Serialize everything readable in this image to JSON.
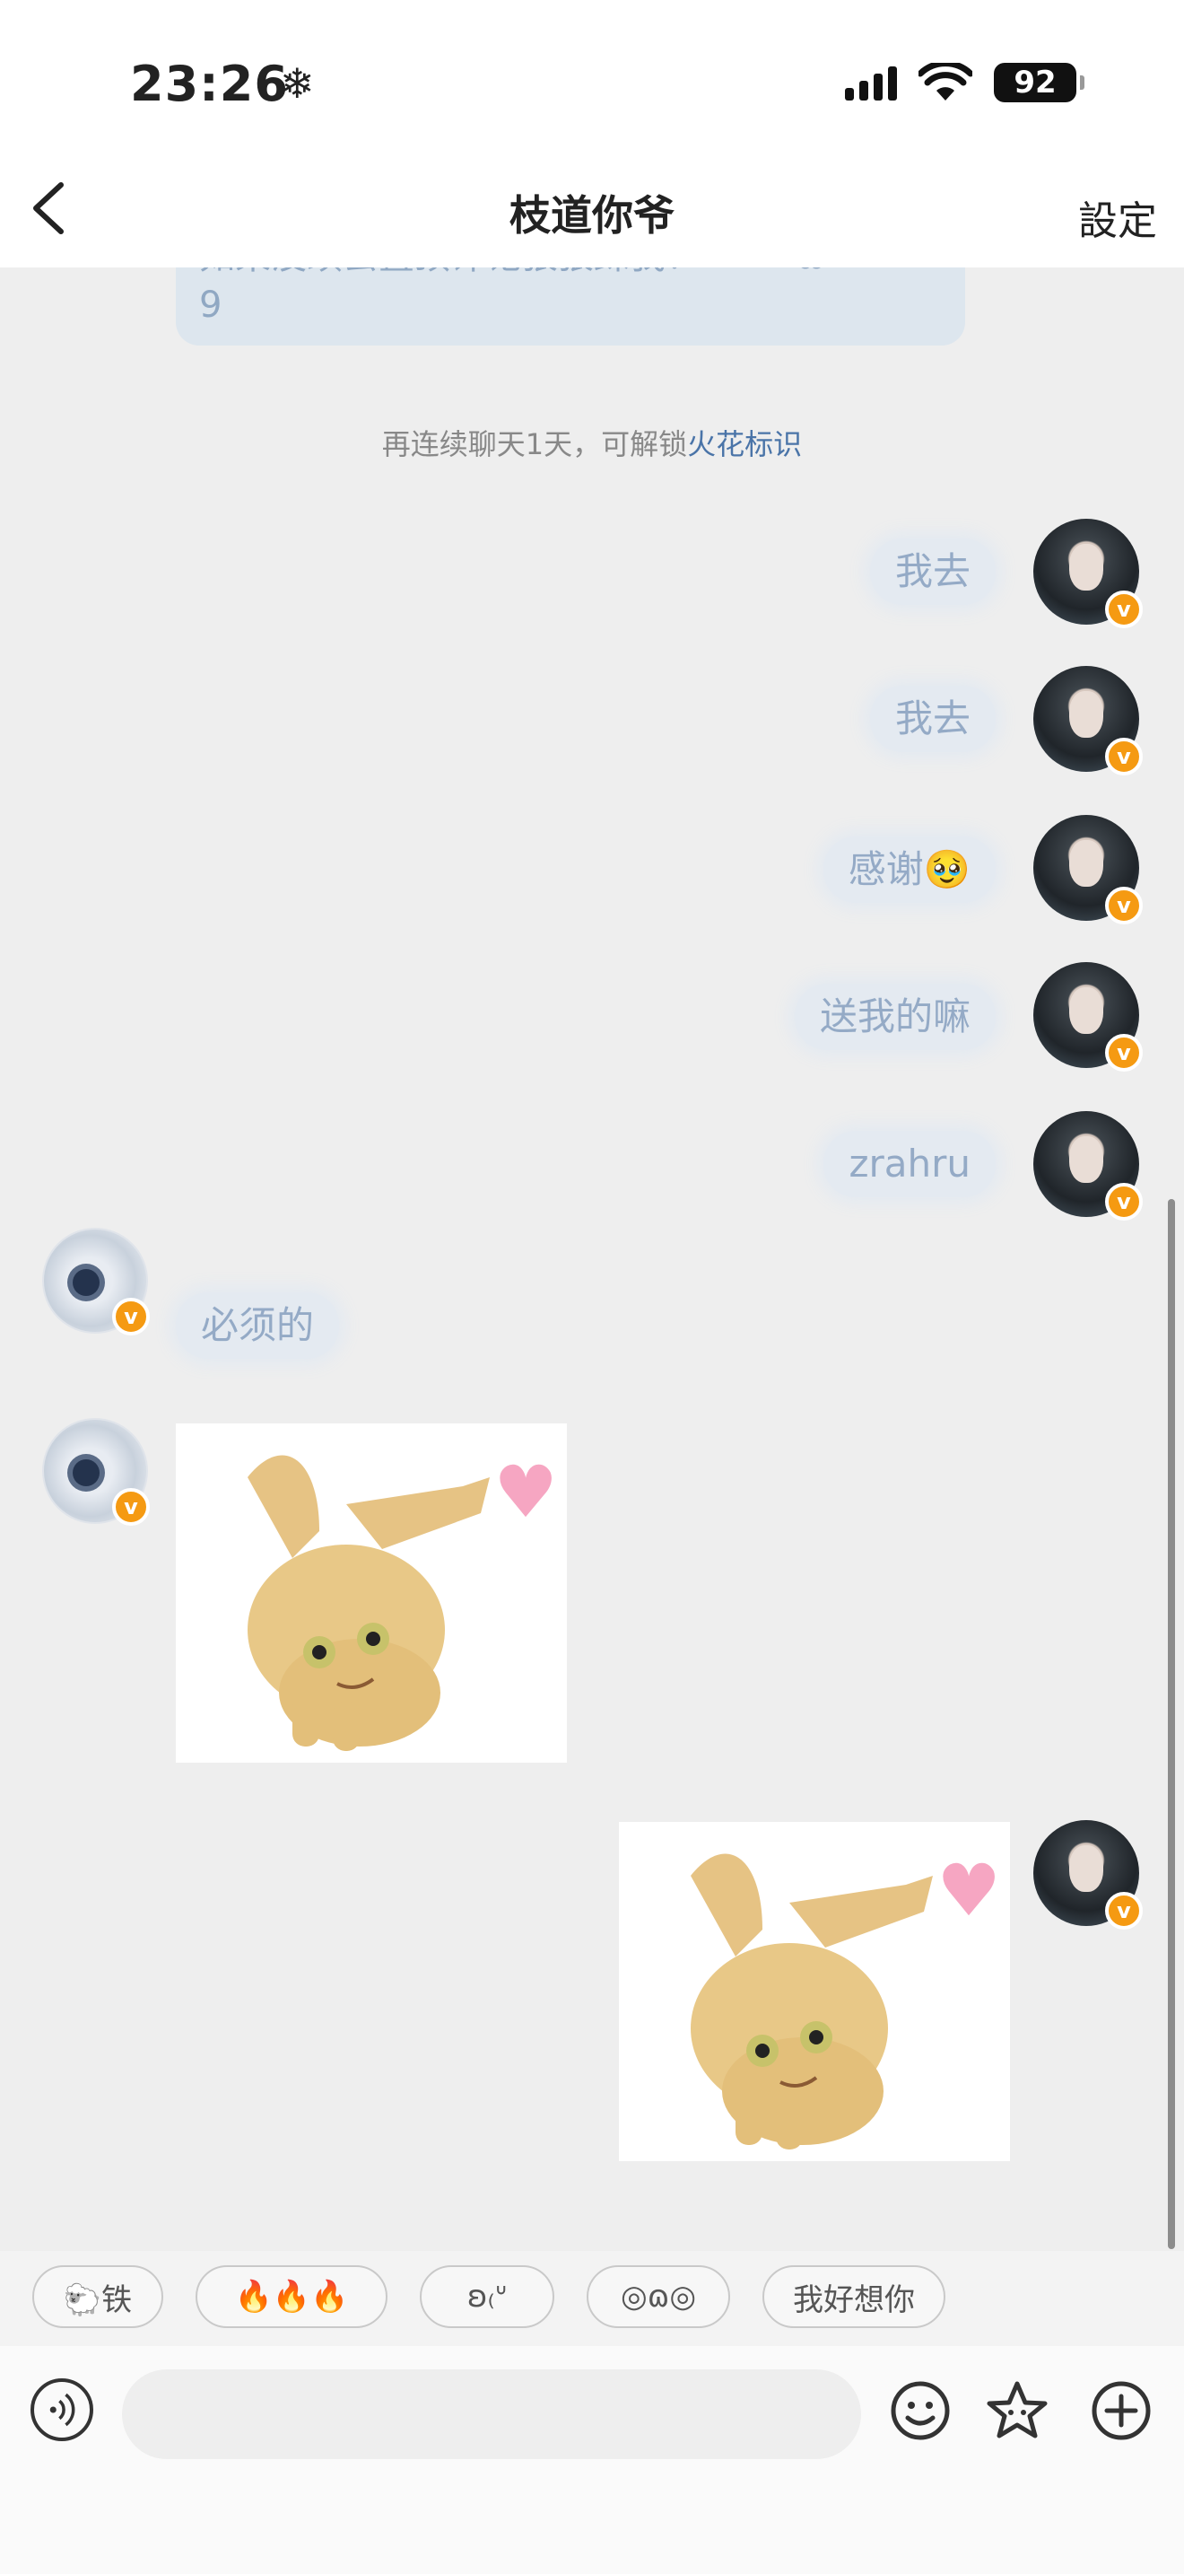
{
  "status_bar": {
    "time": "23:26",
    "battery": "92"
  },
  "header": {
    "title": "枝道你爷",
    "right_action": "設定"
  },
  "clipped_message": {
    "line1": "如果没续去置顶评论狠狠踩我！",
    "line1_suffix": "·ω<",
    "line2": "9"
  },
  "notice": {
    "prefix": "再连续聊天1天，可解锁",
    "link": "火花标识"
  },
  "messages": [
    {
      "side": "right",
      "text": "我去"
    },
    {
      "side": "right",
      "text": "我去"
    },
    {
      "side": "right",
      "text": "感谢🥹"
    },
    {
      "side": "right",
      "text": "送我的嘛"
    },
    {
      "side": "right",
      "text": "zrahru"
    },
    {
      "side": "left",
      "text": "必须的"
    },
    {
      "side": "left",
      "type": "sticker"
    },
    {
      "side": "right",
      "type": "sticker"
    }
  ],
  "badge": {
    "label": "v"
  },
  "quick_replies": [
    "🐑铁",
    "🔥🔥🔥",
    "ʚ₍ᐡ",
    "◎ɷ◎",
    "我好想你"
  ],
  "input": {
    "placeholder": ""
  },
  "icons": [
    "back-icon",
    "voice-icon",
    "emoji-icon",
    "sticker-icon",
    "plus-icon"
  ]
}
